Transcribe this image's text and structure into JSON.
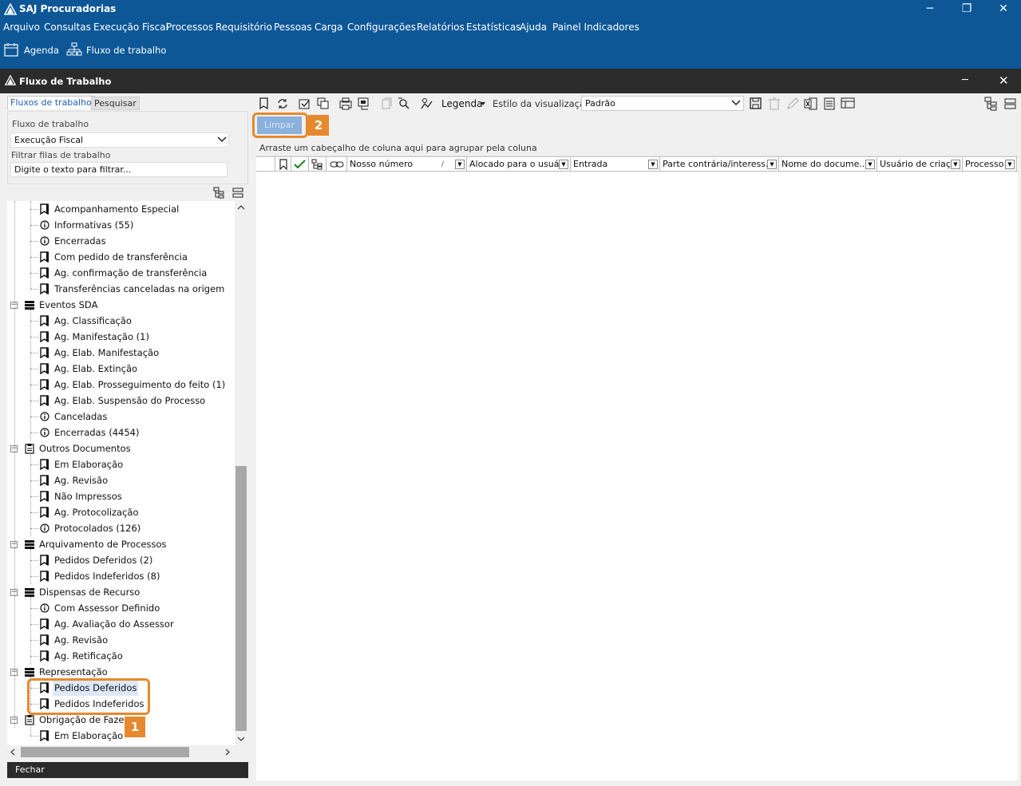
{
  "app": {
    "title": "SAJ Procuradorias"
  },
  "window_controls": {
    "minimize": "─",
    "restore": "❐",
    "close": "✕"
  },
  "menu": [
    "Arquivo",
    "Consultas",
    "Execução Fiscal",
    "Processos",
    "Requisitório",
    "Pessoas",
    "Carga",
    "Configurações",
    "Relatórios",
    "Estatísticas",
    "Ajuda",
    "Painel Indicadores"
  ],
  "quickbar": {
    "agenda": "Agenda",
    "fluxo": "Fluxo de trabalho"
  },
  "window": {
    "title": "Fluxo de Trabalho",
    "minimize": "─",
    "close": "✕"
  },
  "left": {
    "tabs": [
      "Fluxos de trabalho",
      "Pesquisar"
    ],
    "fluxo_label": "Fluxo de trabalho",
    "fluxo_value": "Execução Fiscal",
    "filtrar_label": "Filtrar filas de trabalho",
    "filtrar_placeholder": "Digite o texto para filtrar...",
    "fechar": "Fechar"
  },
  "tree": [
    {
      "label": "Acompanhamento Especial",
      "level": 2,
      "icon": "doc"
    },
    {
      "label": "Informativas (55)",
      "level": 2,
      "icon": "info"
    },
    {
      "label": "Encerradas",
      "level": 2,
      "icon": "info"
    },
    {
      "label": "Com pedido de transferência",
      "level": 2,
      "icon": "doc"
    },
    {
      "label": "Ag. confirmação de transferência",
      "level": 2,
      "icon": "doc"
    },
    {
      "label": "Transferências canceladas na origem",
      "level": 2,
      "icon": "doc"
    },
    {
      "label": "Eventos SDA",
      "level": 1,
      "icon": "group"
    },
    {
      "label": "Ag. Classificação",
      "level": 2,
      "icon": "doc"
    },
    {
      "label": "Ag. Manifestação (1)",
      "level": 2,
      "icon": "doc"
    },
    {
      "label": "Ag. Elab. Manifestação",
      "level": 2,
      "icon": "doc"
    },
    {
      "label": "Ag. Elab. Extinção",
      "level": 2,
      "icon": "doc"
    },
    {
      "label": "Ag. Elab. Prosseguimento do feito (1)",
      "level": 2,
      "icon": "doc"
    },
    {
      "label": "Ag. Elab. Suspensão do Processo",
      "level": 2,
      "icon": "doc"
    },
    {
      "label": "Canceladas",
      "level": 2,
      "icon": "info"
    },
    {
      "label": "Encerradas (4454)",
      "level": 2,
      "icon": "info"
    },
    {
      "label": "Outros Documentos",
      "level": 1,
      "icon": "clip"
    },
    {
      "label": "Em Elaboração",
      "level": 2,
      "icon": "doc"
    },
    {
      "label": "Ag. Revisão",
      "level": 2,
      "icon": "doc"
    },
    {
      "label": "Não Impressos",
      "level": 2,
      "icon": "doc"
    },
    {
      "label": "Ag. Protocolização",
      "level": 2,
      "icon": "doc"
    },
    {
      "label": "Protocolados (126)",
      "level": 2,
      "icon": "info"
    },
    {
      "label": "Arquivamento de Processos",
      "level": 1,
      "icon": "group"
    },
    {
      "label": "Pedidos Deferidos (2)",
      "level": 2,
      "icon": "doc"
    },
    {
      "label": "Pedidos Indeferidos (8)",
      "level": 2,
      "icon": "doc"
    },
    {
      "label": "Dispensas de Recurso",
      "level": 1,
      "icon": "group"
    },
    {
      "label": "Com Assessor Definido",
      "level": 2,
      "icon": "info"
    },
    {
      "label": "Ag. Avaliação do Assessor",
      "level": 2,
      "icon": "doc"
    },
    {
      "label": "Ag. Revisão",
      "level": 2,
      "icon": "doc"
    },
    {
      "label": "Ag. Retificação",
      "level": 2,
      "icon": "doc"
    },
    {
      "label": "Representação",
      "level": 1,
      "icon": "group"
    },
    {
      "label": "Pedidos Deferidos",
      "level": 2,
      "icon": "doc",
      "selected": true
    },
    {
      "label": "Pedidos Indeferidos",
      "level": 2,
      "icon": "doc"
    },
    {
      "label": "Obrigação de Fazer",
      "level": 1,
      "icon": "clip"
    },
    {
      "label": "Em Elaboração",
      "level": 2,
      "icon": "doc"
    }
  ],
  "toolbar": {
    "legenda": "Legenda",
    "estilo_label": "Estilo da visualização",
    "estilo_value": "Padrão",
    "limpar": "Limpar"
  },
  "grid": {
    "group_hint": "Arraste um cabeçalho de coluna aqui para agrupar pela coluna",
    "columns": [
      "Nosso número",
      "Alocado para o usuá...",
      "Entrada",
      "Parte contrária/interess...",
      "Nome do docume...",
      "Usuário de criaç...",
      "Processo"
    ]
  },
  "annotations": {
    "badge1": "1",
    "badge2": "2"
  },
  "colors": {
    "titlebar": "#0d5797",
    "dark": "#2b2b2b",
    "accent": "#e6892e"
  }
}
